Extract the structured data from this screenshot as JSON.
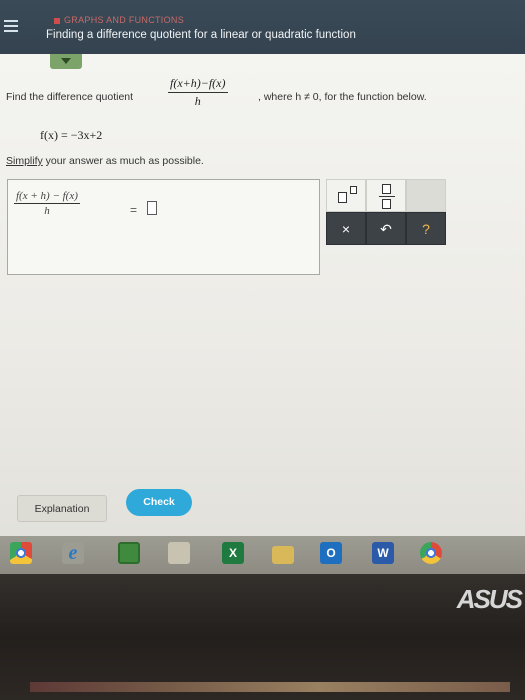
{
  "header": {
    "topic": "GRAPHS AND FUNCTIONS",
    "title": "Finding a difference quotient for a linear or quadratic function"
  },
  "problem": {
    "prompt": "Find the difference quotient",
    "quotient_num": "f(x+h)−f(x)",
    "quotient_den": "h",
    "condition": ", where h ≠ 0, for the function below.",
    "function": "f(x) = −3x+2",
    "instruction_link": "Simplify",
    "instruction_rest": " your answer as much as possible."
  },
  "answer": {
    "lhs_num": "f(x + h) − f(x)",
    "lhs_den": "h",
    "equals": "="
  },
  "keypad": {
    "clear": "×",
    "undo": "↶",
    "help": "?"
  },
  "buttons": {
    "explanation": "Explanation",
    "check": "Check"
  },
  "taskbar": {
    "icons": [
      "chrome-icon",
      "edge-icon",
      "store-icon",
      "photos-icon",
      "excel-icon",
      "file-explorer-icon",
      "outlook-icon",
      "word-icon",
      "chrome-icon"
    ]
  },
  "brand": "ASUS",
  "colors": {
    "header": "#3a4a57",
    "check": "#2fa9d9",
    "keypad_dark": "#3d4247",
    "help": "#f0b64a"
  }
}
